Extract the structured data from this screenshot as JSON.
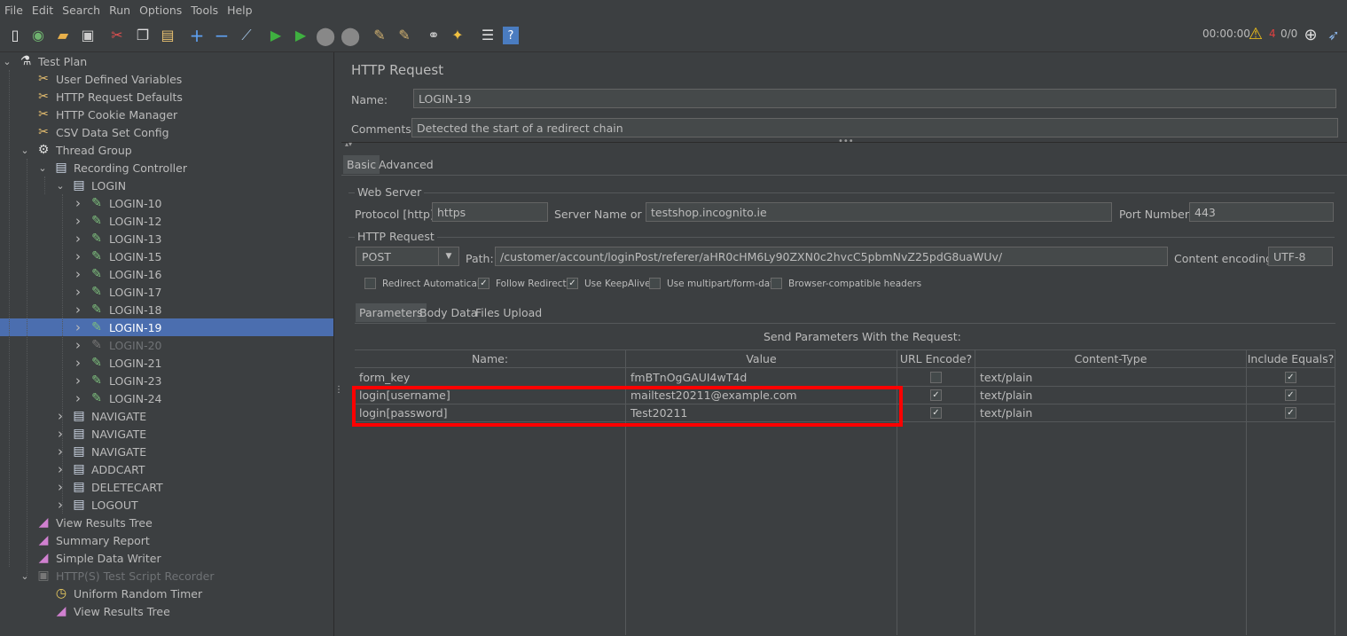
{
  "menu": [
    "File",
    "Edit",
    "Search",
    "Run",
    "Options",
    "Tools",
    "Help"
  ],
  "toolbar": {
    "elapsed": "00:00:00",
    "warnings": "4",
    "threads": "0/0"
  },
  "tree": [
    {
      "label": "Test Plan",
      "icon": "flask-icon",
      "level": 0,
      "chev": "down"
    },
    {
      "label": "User Defined Variables",
      "icon": "wrench-scissors-icon",
      "level": 1
    },
    {
      "label": "HTTP Request Defaults",
      "icon": "wrench-scissors-icon",
      "level": 1
    },
    {
      "label": "HTTP Cookie Manager",
      "icon": "wrench-scissors-icon",
      "level": 1
    },
    {
      "label": "CSV Data Set Config",
      "icon": "wrench-scissors-icon",
      "level": 1
    },
    {
      "label": "Thread Group",
      "icon": "gear-icon",
      "level": 1,
      "chev": "down"
    },
    {
      "label": "Recording Controller",
      "icon": "controller-icon",
      "level": 2,
      "chev": "down"
    },
    {
      "label": "LOGIN",
      "icon": "controller-icon",
      "level": 3,
      "chev": "down"
    },
    {
      "label": "LOGIN-10",
      "icon": "pipette-icon",
      "level": 4,
      "chev": "right"
    },
    {
      "label": "LOGIN-12",
      "icon": "pipette-icon",
      "level": 4,
      "chev": "right"
    },
    {
      "label": "LOGIN-13",
      "icon": "pipette-icon",
      "level": 4,
      "chev": "right"
    },
    {
      "label": "LOGIN-15",
      "icon": "pipette-icon",
      "level": 4,
      "chev": "right"
    },
    {
      "label": "LOGIN-16",
      "icon": "pipette-icon",
      "level": 4,
      "chev": "right"
    },
    {
      "label": "LOGIN-17",
      "icon": "pipette-icon",
      "level": 4,
      "chev": "right"
    },
    {
      "label": "LOGIN-18",
      "icon": "pipette-icon",
      "level": 4,
      "chev": "right"
    },
    {
      "label": "LOGIN-19",
      "icon": "pipette-icon",
      "level": 4,
      "chev": "right",
      "selected": true
    },
    {
      "label": "LOGIN-20",
      "icon": "pipette-icon",
      "level": 4,
      "chev": "right",
      "disabled": true
    },
    {
      "label": "LOGIN-21",
      "icon": "pipette-icon",
      "level": 4,
      "chev": "right"
    },
    {
      "label": "LOGIN-23",
      "icon": "pipette-icon",
      "level": 4,
      "chev": "right"
    },
    {
      "label": "LOGIN-24",
      "icon": "pipette-icon",
      "level": 4,
      "chev": "right"
    },
    {
      "label": "NAVIGATE",
      "icon": "controller-icon",
      "level": 3,
      "chev": "right"
    },
    {
      "label": "NAVIGATE",
      "icon": "controller-icon",
      "level": 3,
      "chev": "right"
    },
    {
      "label": "NAVIGATE",
      "icon": "controller-icon",
      "level": 3,
      "chev": "right"
    },
    {
      "label": "ADDCART",
      "icon": "controller-icon",
      "level": 3,
      "chev": "right"
    },
    {
      "label": "DELETECART",
      "icon": "controller-icon",
      "level": 3,
      "chev": "right"
    },
    {
      "label": "LOGOUT",
      "icon": "controller-icon",
      "level": 3,
      "chev": "right"
    },
    {
      "label": "View Results Tree",
      "icon": "graph-icon",
      "level": 1
    },
    {
      "label": "Summary Report",
      "icon": "graph-icon",
      "level": 1
    },
    {
      "label": "Simple Data Writer",
      "icon": "graph-icon",
      "level": 1
    },
    {
      "label": "HTTP(S) Test Script Recorder",
      "icon": "recorder-icon",
      "level": 1,
      "chev": "down",
      "disabled": true
    },
    {
      "label": "Uniform Random Timer",
      "icon": "timer-icon",
      "level": 2
    },
    {
      "label": "View Results Tree",
      "icon": "graph-icon",
      "level": 2
    }
  ],
  "panel": {
    "title": "HTTP Request",
    "name_label": "Name:",
    "name_value": "LOGIN-19",
    "comments_label": "Comments:",
    "comments_value": "Detected the start of a redirect chain",
    "tabs": [
      "Basic",
      "Advanced"
    ],
    "web_server_legend": "Web Server",
    "protocol_label": "Protocol [http]:",
    "protocol_value": "https",
    "server_label": "Server Name or IP:",
    "server_value": "testshop.incognito.ie",
    "port_label": "Port Number:",
    "port_value": "443",
    "http_request_legend": "HTTP Request",
    "method_value": "POST",
    "path_label": "Path:",
    "path_value": "/customer/account/loginPost/referer/aHR0cHM6Ly90ZXN0c2hvcC5pbmNvZ25pdG8uaWUv/",
    "encoding_label": "Content encoding:",
    "encoding_value": "UTF-8",
    "options": [
      {
        "label": "Redirect Automatically",
        "checked": false
      },
      {
        "label": "Follow Redirects",
        "checked": true
      },
      {
        "label": "Use KeepAlive",
        "checked": true
      },
      {
        "label": "Use multipart/form-data",
        "checked": false
      },
      {
        "label": "Browser-compatible headers",
        "checked": false
      }
    ],
    "subtabs": [
      "Parameters",
      "Body Data",
      "Files Upload"
    ],
    "params_caption": "Send Parameters With the Request:",
    "columns": [
      "Name:",
      "Value",
      "URL Encode?",
      "Content-Type",
      "Include Equals?"
    ],
    "rows": [
      {
        "name": "form_key",
        "value": "fmBTnOgGAUI4wT4d",
        "encode": false,
        "type": "text/plain",
        "equals": true
      },
      {
        "name": "login[username]",
        "value": "mailtest20211@example.com",
        "encode": true,
        "type": "text/plain",
        "equals": true
      },
      {
        "name": "login[password]",
        "value": "Test20211",
        "encode": true,
        "type": "text/plain",
        "equals": true
      }
    ]
  },
  "colors": {
    "selection": "#4b6eaf",
    "highlight": "#ff0000",
    "background": "#3c3f41"
  }
}
